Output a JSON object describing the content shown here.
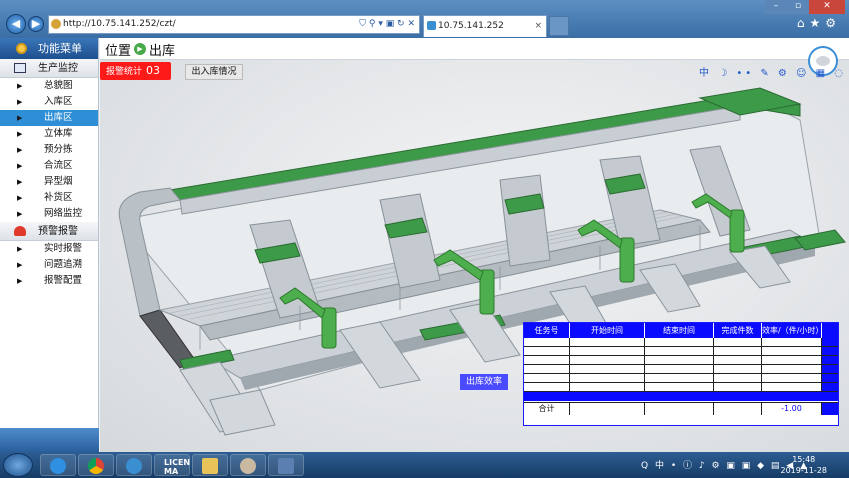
{
  "browser": {
    "url": "http://10.75.141.252/czt/",
    "tab_title": "10.75.141.252",
    "tab_close": "×",
    "url_tools": "⛉ ⚲ ▾ ▣ ↻ ✕"
  },
  "sidebar": {
    "header": "功能菜单",
    "groups": [
      {
        "label": "生产监控",
        "items": [
          "总貌图",
          "入库区",
          "出库区",
          "立体库",
          "预分拣",
          "合流区",
          "异型烟",
          "补货区",
          "网络监控"
        ]
      },
      {
        "label": "预警报警",
        "items": [
          "实时报警",
          "问题追溯",
          "报警配置"
        ]
      }
    ],
    "active_item": "出库区"
  },
  "header": {
    "location_label": "位置",
    "page_title": "出库"
  },
  "toolbar": {
    "alarm_label": "报警统计",
    "alarm_count": "03",
    "io_button": "出入库情况",
    "tool_icons": "中 ☽ •• ✎ ⚙ ☺ ▦ ◌"
  },
  "stats_table": {
    "columns": [
      "任务号",
      "开始时间",
      "结束时间",
      "完成件数",
      "效率/（件/小时）"
    ],
    "total_label": "合计",
    "total_value": "-1.00"
  },
  "efficiency_button": "出库效率",
  "taskbar": {
    "time": "15:48",
    "date": "2019-11-28",
    "app_text": "LICEN MA",
    "tray": "Q 中 • ⓘ ♪ ⚙ ▣ ▣ ◆ ▤ ◀ ▲"
  },
  "colors": {
    "accent_blue": "#0a0aff",
    "alarm_red": "#ff1a1a",
    "active_menu": "#2f8fd6"
  }
}
